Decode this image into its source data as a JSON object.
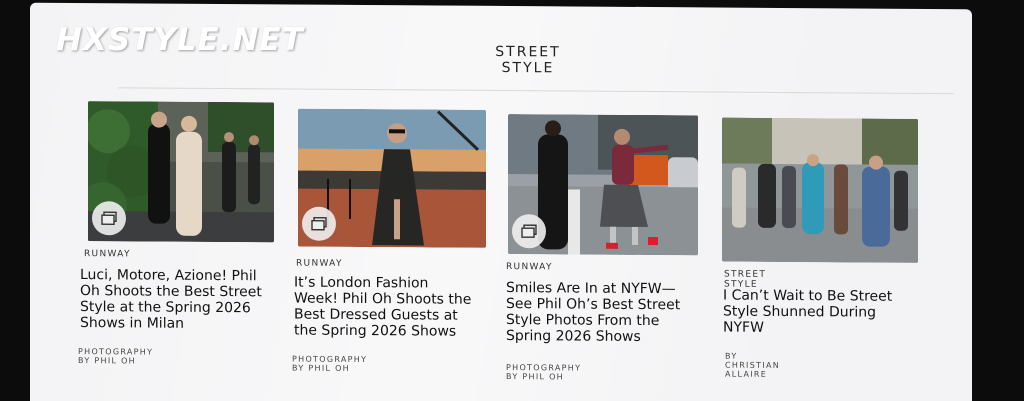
{
  "watermark": "HXSTYLE.NET",
  "section": {
    "title_line1": "STREET",
    "title_line2": "STYLE"
  },
  "cards": [
    {
      "rubric": "RUNWAY",
      "headline": [
        "Luci, Motore, Azione! Phil",
        "Oh Shoots the Best Street",
        "Style at the Spring 2026",
        "Shows in Milan"
      ],
      "credit": "PHOTOGRAPHY BY PHIL OH",
      "icon": "gallery-icon"
    },
    {
      "rubric": "RUNWAY",
      "headline": [
        "It’s London Fashion",
        "Week! Phil Oh Shoots the",
        "Best Dressed Guests at",
        "the Spring 2026 Shows"
      ],
      "credit": "PHOTOGRAPHY BY PHIL OH",
      "icon": "gallery-icon"
    },
    {
      "rubric": "RUNWAY",
      "headline": [
        "Smiles Are In at NYFW—",
        "See Phil Oh’s Best Street",
        "Style Photos From the",
        "Spring 2026 Shows"
      ],
      "credit": "PHOTOGRAPHY BY PHIL OH",
      "icon": "gallery-icon"
    },
    {
      "rubric": "STREET STYLE",
      "headline": [
        "I Can’t Wait to Be Street",
        "Style Shunned During",
        "NYFW"
      ],
      "credit": "BY CHRISTIAN ALLAIRE"
    }
  ]
}
